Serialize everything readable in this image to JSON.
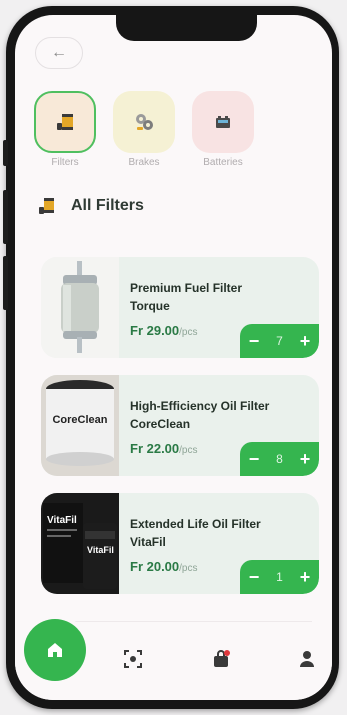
{
  "header": {
    "back_icon": "arrow-left-icon",
    "back_glyph": "←"
  },
  "categories": [
    {
      "label": "Filters",
      "icon": "oil-filter-icon",
      "bg": "#f8e9d8",
      "selected": true
    },
    {
      "label": "Brakes",
      "icon": "brake-parts-icon",
      "bg": "#f5f1d4",
      "selected": false
    },
    {
      "label": "Batteries",
      "icon": "battery-icon",
      "bg": "#f8e3e3",
      "selected": false
    }
  ],
  "section": {
    "title": "All Filters",
    "icon": "oil-filter-icon"
  },
  "products": [
    {
      "title": "Premium Fuel Filter Torque",
      "price": "Fr 29.00",
      "unit": "/pcs",
      "qty": "7",
      "image": "fuel-filter-image"
    },
    {
      "title": "High-Efficiency Oil Filter CoreClean",
      "price": "Fr 22.00",
      "unit": "/pcs",
      "qty": "8",
      "image": "oil-filter-coreclean-image",
      "brand_text": "CoreClean"
    },
    {
      "title": "Extended Life Oil Filter VitaFil",
      "price": "Fr 20.00",
      "unit": "/pcs",
      "qty": "1",
      "image": "oil-filter-vitafil-image",
      "brand_text": "VitaFil"
    }
  ],
  "stepper": {
    "minus": "−",
    "plus": "+"
  },
  "nav": [
    {
      "name": "home",
      "icon": "home-icon",
      "active": true
    },
    {
      "name": "scan",
      "icon": "scan-icon",
      "active": false
    },
    {
      "name": "cart",
      "icon": "shopping-bag-icon",
      "active": false,
      "badge": true
    },
    {
      "name": "profile",
      "icon": "user-icon",
      "active": false
    }
  ],
  "colors": {
    "accent": "#35b54f",
    "price": "#2a7a45",
    "title": "#2f3a34",
    "card_bg": "#eaf1ec",
    "selected_border": "#4fbf5f"
  }
}
